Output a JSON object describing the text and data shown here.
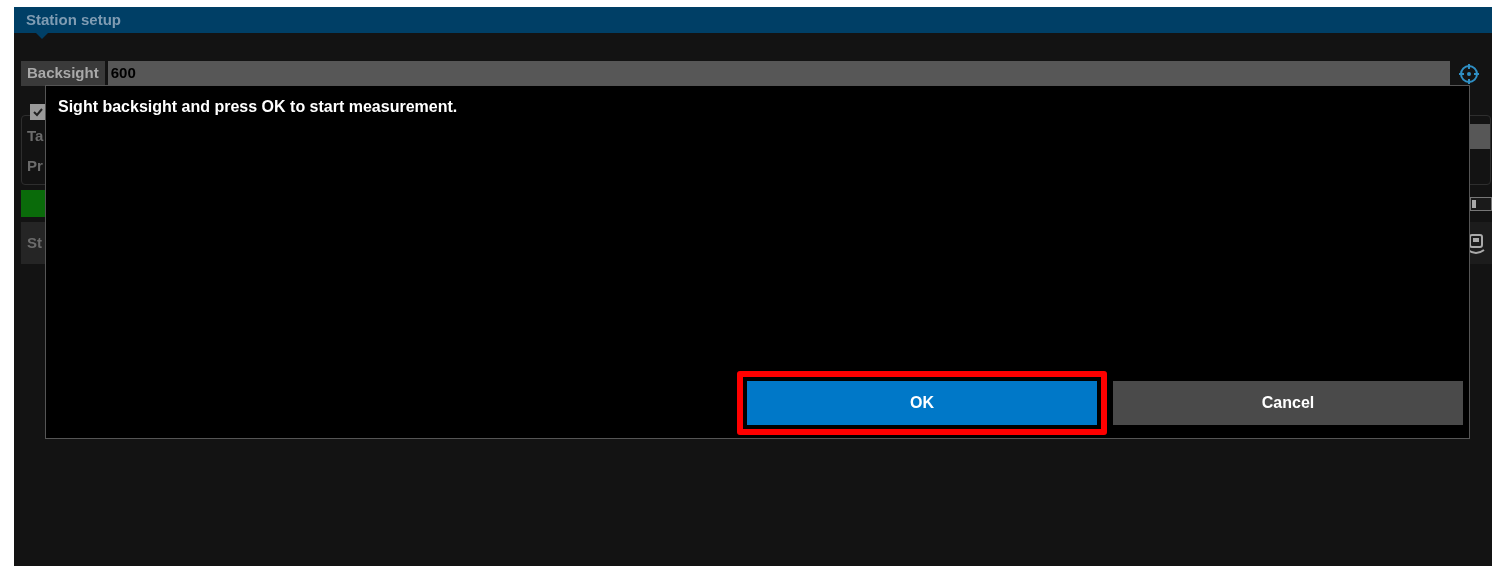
{
  "window": {
    "title": "Station setup"
  },
  "backsight": {
    "label": "Backsight",
    "value": "600"
  },
  "prism_option": {
    "checked": true
  },
  "target_height": {
    "label": "Ta"
  },
  "prism_constant": {
    "label": "Pr"
  },
  "tracking": {
    "on": true
  },
  "stop_button": {
    "label": "St"
  },
  "dialog": {
    "message": "Sight backsight and press OK to start measurement.",
    "buttons": [
      {
        "label": "OK",
        "kind": "primary",
        "highlighted": true
      },
      {
        "label": "Cancel",
        "kind": "secondary",
        "highlighted": false
      }
    ]
  }
}
